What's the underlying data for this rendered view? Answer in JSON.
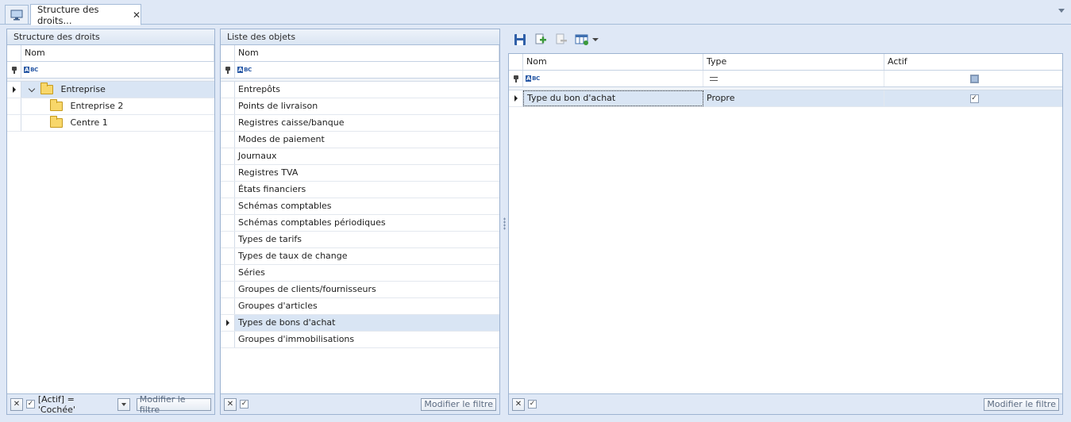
{
  "tab": {
    "title": "Structure des droits...",
    "close": "✕"
  },
  "left_panel": {
    "title": "Structure des droits",
    "column_nom": "Nom",
    "tree": [
      {
        "label": "Entreprise",
        "level": 0
      },
      {
        "label": "Entreprise 2",
        "level": 1
      },
      {
        "label": "Centre 1",
        "level": 1
      }
    ],
    "footer": {
      "filter_text": "[Actif] = 'Cochée'",
      "modify_filter": "Modifier le filtre"
    }
  },
  "middle_panel": {
    "title": "Liste des objets",
    "column_nom": "Nom",
    "items": [
      "Entrepôts",
      "Points de livraison",
      "Registres caisse/banque",
      "Modes de paiement",
      "Journaux",
      "Registres TVA",
      "États financiers",
      "Schémas comptables",
      "Schémas comptables périodiques",
      "Types de tarifs",
      "Types de taux de change",
      "Séries",
      "Groupes de clients/fournisseurs",
      "Groupes d'articles",
      "Types de bons d'achat",
      "Groupes d'immobilisations"
    ],
    "selected_index": 14,
    "footer": {
      "modify_filter": "Modifier le filtre"
    }
  },
  "right_panel": {
    "columns": {
      "nom": "Nom",
      "type": "Type",
      "actif": "Actif"
    },
    "rows": [
      {
        "nom": "Type du bon d'achat",
        "type": "Propre",
        "actif": "✓"
      }
    ],
    "footer": {
      "modify_filter": "Modifier le filtre"
    }
  },
  "icons": {
    "check": "✓",
    "close_x": "✕"
  }
}
